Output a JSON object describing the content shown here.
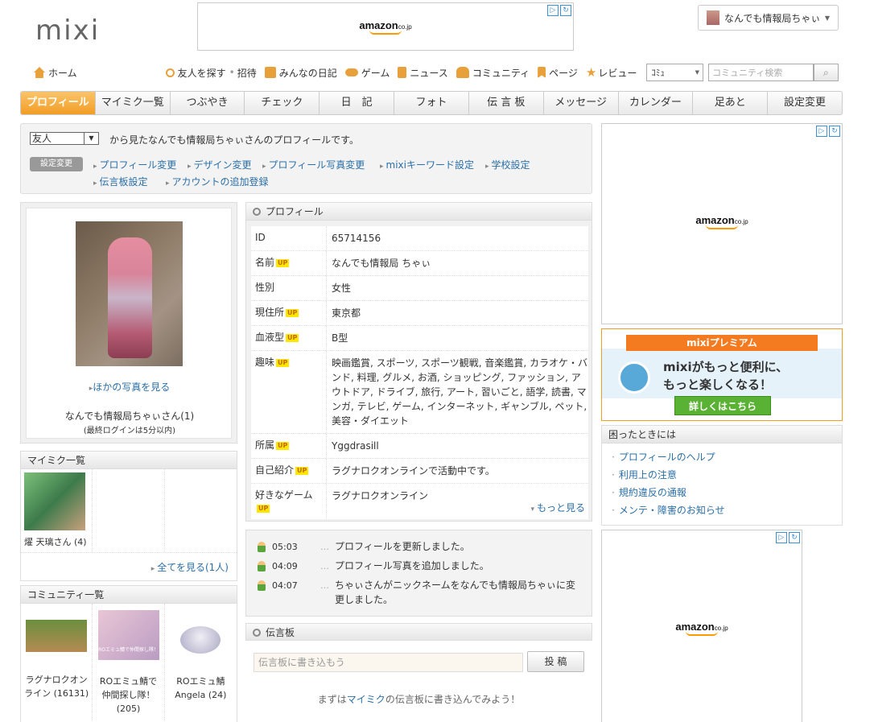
{
  "header": {
    "logo": "mixi",
    "user_name": "なんでも情報局ちゃぃ",
    "ad_label": "amazon",
    "ad_suffix": "co.jp"
  },
  "global_nav": {
    "home": "ホーム",
    "find_friends": "友人を探す",
    "invite": "招待",
    "diary": "みんなの日記",
    "game": "ゲーム",
    "news": "ニュース",
    "community": "コミュニティ",
    "page": "ページ",
    "review": "レビュー",
    "search_scope": "ｺﾐｭ",
    "search_placeholder": "コミュニティ検索"
  },
  "tabs": [
    "プロフィール",
    "マイミク一覧",
    "つぶやき",
    "チェック",
    "日　記",
    "フォト",
    "伝 言 板",
    "メッセージ",
    "カレンダー",
    "足あと",
    "設定変更"
  ],
  "settings": {
    "view_as": "友人",
    "view_text": "から見たなんでも情報局ちゃぃさんのプロフィールです。",
    "badge": "設定変更",
    "links": [
      "プロフィール変更",
      "デザイン変更",
      "プロフィール写真変更",
      "mixiキーワード設定",
      "学校設定",
      "伝言板設定",
      "アカウントの追加登録"
    ]
  },
  "photo": {
    "other_photos": "ほかの写真を見る",
    "nickname": "なんでも情報局ちゃぃさん(1)",
    "last_login": "(最終ログインは5分以内)"
  },
  "mymixi": {
    "title": "マイミク一覧",
    "friends": [
      {
        "name": "燿 天璃さん (4)"
      }
    ],
    "all_link": "全てを見る(1人)"
  },
  "communities": {
    "title": "コミュニティ一覧",
    "items": [
      {
        "name": "ラグナロクオンライン (16131)"
      },
      {
        "name": "ROエミュ鯖で仲間探し隊！ (205)"
      },
      {
        "name": "ROエミュ鯖Angela (24)"
      }
    ],
    "thumb_text": "ROエミュ鯖で仲間探し隊！"
  },
  "profile": {
    "title": "プロフィール",
    "rows": [
      {
        "key": "ID",
        "value": "65714156",
        "up": ""
      },
      {
        "key": "名前",
        "value": "なんでも情報局 ちゃぃ",
        "up": "UP"
      },
      {
        "key": "性別",
        "value": "女性",
        "up": ""
      },
      {
        "key": "現住所",
        "value": "東京都",
        "up": "UP"
      },
      {
        "key": "血液型",
        "value": "B型",
        "up": "UP"
      },
      {
        "key": "趣味",
        "value": "映画鑑賞, スポーツ, スポーツ観戦, 音楽鑑賞, カラオケ・バンド, 料理, グルメ, お酒, ショッピング, ファッション, アウトドア, ドライブ, 旅行, アート, 習いごと, 語学, 読書, マンガ, テレビ, ゲーム, インターネット, ギャンブル, ペット, 美容・ダイエット",
        "up": "UP"
      },
      {
        "key": "所属",
        "value": "Yggdrasill",
        "up": "UP"
      },
      {
        "key": "自己紹介",
        "value": "ラグナロクオンラインで活動中です。",
        "up": "UP"
      },
      {
        "key": "好きなゲーム",
        "value": "ラグナロクオンライン",
        "up": "UP"
      }
    ],
    "more": "もっと見る"
  },
  "activity": [
    {
      "time": "05:03",
      "text": "プロフィールを更新しました。"
    },
    {
      "time": "04:09",
      "text": "プロフィール写真を追加しました。"
    },
    {
      "time": "04:07",
      "text": "ちゃぃさんがニックネームをなんでも情報局ちゃぃに変更しました。"
    }
  ],
  "board": {
    "title": "伝言板",
    "placeholder": "伝言板に書き込もう",
    "post": "投 稿",
    "note_pre": "まずは",
    "note_link": "マイミク",
    "note_post": "の伝言板に書き込んでみよう！"
  },
  "premium": {
    "ribbon": "mixiプレミアム",
    "line1": "mixiがもっと便利に、",
    "line2": "もっと楽しくなる！",
    "button": "詳しくはこちら"
  },
  "help": {
    "title": "困ったときには",
    "links": [
      "プロフィールのヘルプ",
      "利用上の注意",
      "規約違反の通報",
      "メンテ・障害のお知らせ"
    ]
  },
  "colors": {
    "accent": "#f19d24",
    "link": "#2a6fa8",
    "premium_button": "#5ab234"
  }
}
